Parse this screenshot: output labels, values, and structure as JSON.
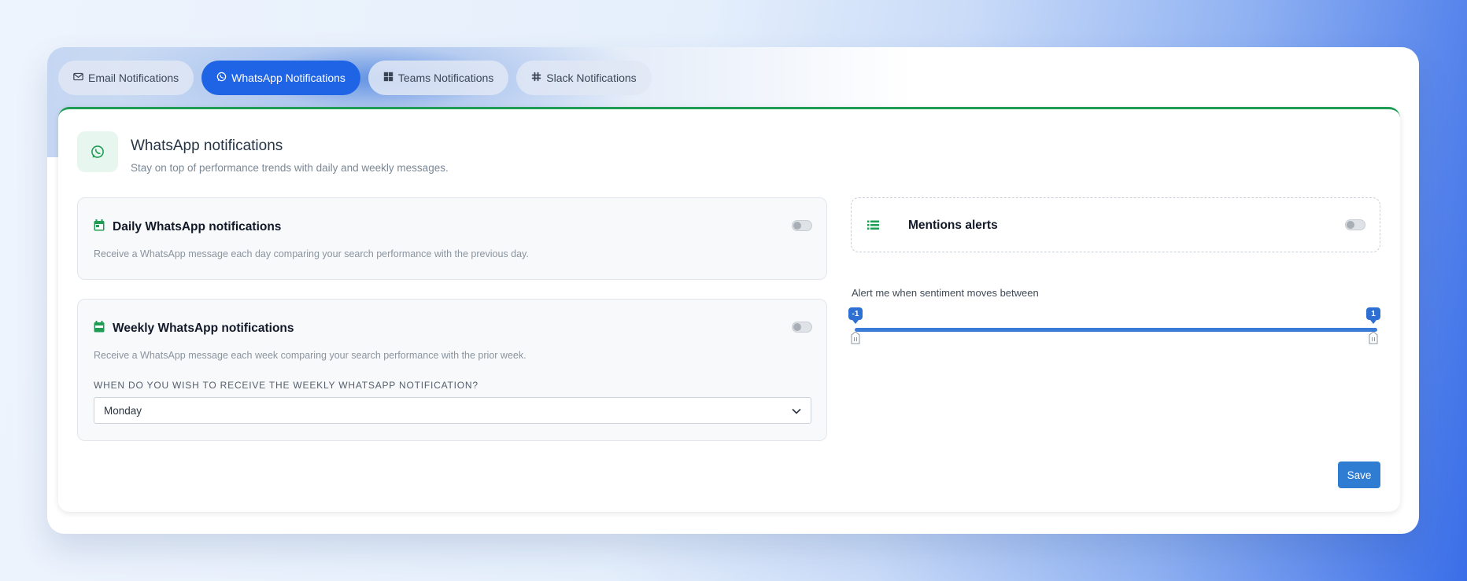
{
  "tabs": [
    {
      "label": "Email Notifications",
      "icon": "envelope-icon",
      "active": false
    },
    {
      "label": "WhatsApp Notifications",
      "icon": "whatsapp-icon",
      "active": true
    },
    {
      "label": "Teams Notifications",
      "icon": "windows-grid-icon",
      "active": false
    },
    {
      "label": "Slack Notifications",
      "icon": "slack-icon",
      "active": false
    }
  ],
  "header": {
    "title": "WhatsApp notifications",
    "subtitle": "Stay on top of performance trends with daily and weekly messages.",
    "icon": "whatsapp-icon"
  },
  "daily": {
    "title": "Daily WhatsApp notifications",
    "description": "Receive a WhatsApp message each day comparing your search performance with the previous day.",
    "enabled": false,
    "icon": "calendar-icon"
  },
  "weekly": {
    "title": "Weekly WhatsApp notifications",
    "description": "Receive a WhatsApp message each week comparing your search performance with the prior week.",
    "enabled": false,
    "icon": "calendar-week-icon",
    "day_label": "When do you wish to receive the weekly WhatsApp notification?",
    "day_value": "Monday"
  },
  "mentions": {
    "title": "Mentions alerts",
    "enabled": false,
    "icon": "list-icon",
    "slider_caption": "Alert me when sentiment moves between",
    "min_value": "-1",
    "max_value": "1"
  },
  "actions": {
    "save_label": "Save"
  },
  "colors": {
    "accent": "#2064e6",
    "whatsapp_green": "#1f9d55",
    "save_button": "#2f7cd3",
    "slider": "#3b7bd8"
  }
}
